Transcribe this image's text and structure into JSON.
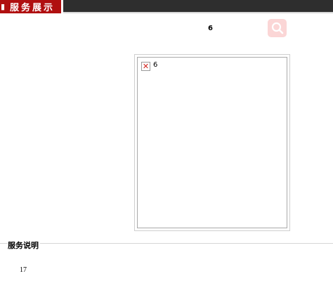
{
  "header": {
    "tab_label": "服务展示",
    "tab_icon": "book-icon",
    "bar_color": "#2e2e2e",
    "tab_color": "#b00f10"
  },
  "service": {
    "title": "6",
    "image_alt": "6",
    "zoom_icon": "magnifier-icon"
  },
  "description": {
    "heading": "服务说明",
    "body": "17"
  }
}
